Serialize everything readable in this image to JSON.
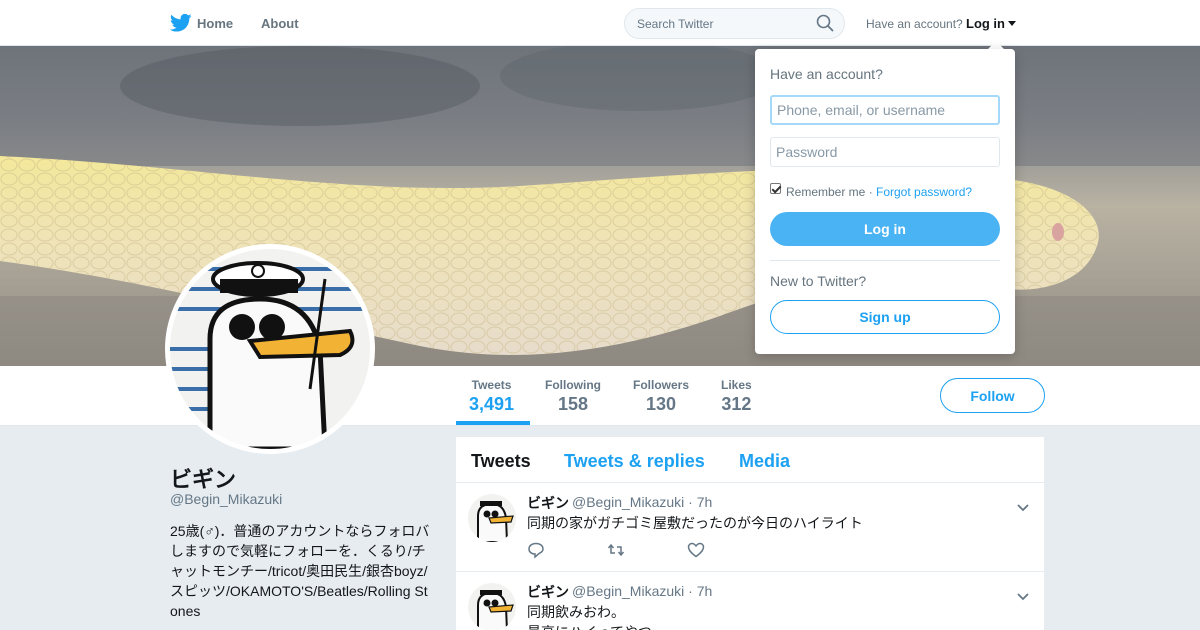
{
  "nav": {
    "home_label": "Home",
    "about_label": "About",
    "search_placeholder": "Search Twitter",
    "have_account_label": "Have an account?",
    "login_label": "Log in"
  },
  "login_dropdown": {
    "title": "Have an account?",
    "username_placeholder": "Phone, email, or username",
    "password_placeholder": "Password",
    "remember_label": "Remember me",
    "separator": "·",
    "forgot_label": "Forgot password?",
    "login_button": "Log in",
    "new_label": "New to Twitter?",
    "signup_button": "Sign up"
  },
  "profile": {
    "name": "ビギン",
    "handle": "@Begin_Mikazuki",
    "bio": "25歳(♂)．普通のアカウントならフォロバしますので気軽にフォローを．くるり/チャットモンチー/tricot/奥田民生/銀杏boyz/スピッツ/OKAMOTO'S/Beatles/Rolling Stones",
    "stats": [
      {
        "label": "Tweets",
        "value": "3,491"
      },
      {
        "label": "Following",
        "value": "158"
      },
      {
        "label": "Followers",
        "value": "130"
      },
      {
        "label": "Likes",
        "value": "312"
      }
    ],
    "follow_button": "Follow"
  },
  "timeline": {
    "tabs": [
      "Tweets",
      "Tweets & replies",
      "Media"
    ],
    "tweets": [
      {
        "name": "ビギン",
        "handle": "@Begin_Mikazuki · 7h",
        "text": "同期の家がガチゴミ屋敷だったのが今日のハイライト"
      },
      {
        "name": "ビギン",
        "handle": "@Begin_Mikazuki · 7h",
        "text": "同期飲みおわ。",
        "text2": "最高にハイってやつ"
      }
    ]
  },
  "colors": {
    "accent": "#1da1f2",
    "login_button": "#4ab3f4",
    "background": "#e6ecf0"
  },
  "icons": [
    "twitter-bird-icon",
    "search-icon",
    "caret-down-icon",
    "reply-icon",
    "retweet-icon",
    "like-icon",
    "chevron-down-icon"
  ]
}
